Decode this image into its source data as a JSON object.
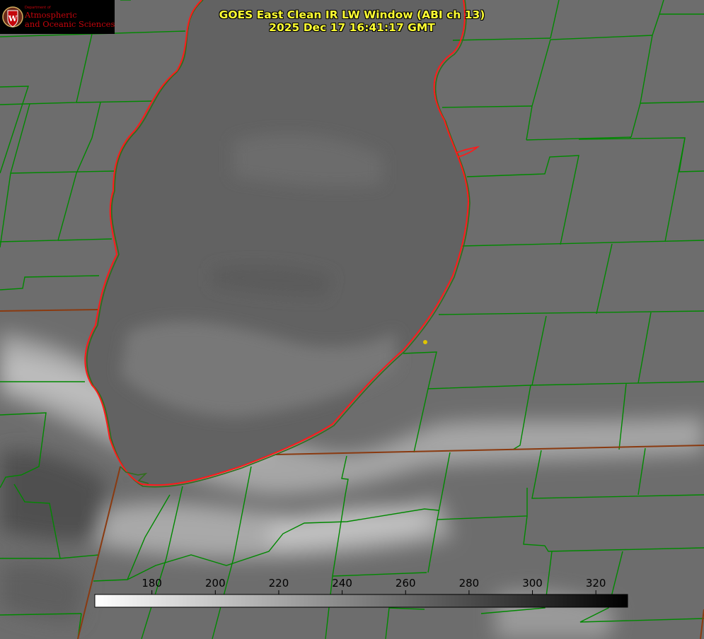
{
  "title": {
    "line1": "GOES East Clean IR LW Window (ABI ch 13)",
    "line2": "2025 Dec 17 16:41:17 GMT"
  },
  "logo": {
    "dept": "Department of",
    "line1": "Atmospheric",
    "line2": "and Oceanic Sciences",
    "seal_letter": "W"
  },
  "colorbar": {
    "ticks": [
      "180",
      "200",
      "220",
      "240",
      "260",
      "280",
      "300",
      "320"
    ],
    "range_min": 162,
    "range_max": 330,
    "colors": [
      "#ffffff",
      "#000000"
    ]
  },
  "colors": {
    "county_border": "#008800",
    "state_border": "#8a3a10",
    "lake_outline": "#ff1a1a",
    "title_text": "#ffff33",
    "station_marker": "#e0c400",
    "logo_red": "#c5050c"
  }
}
